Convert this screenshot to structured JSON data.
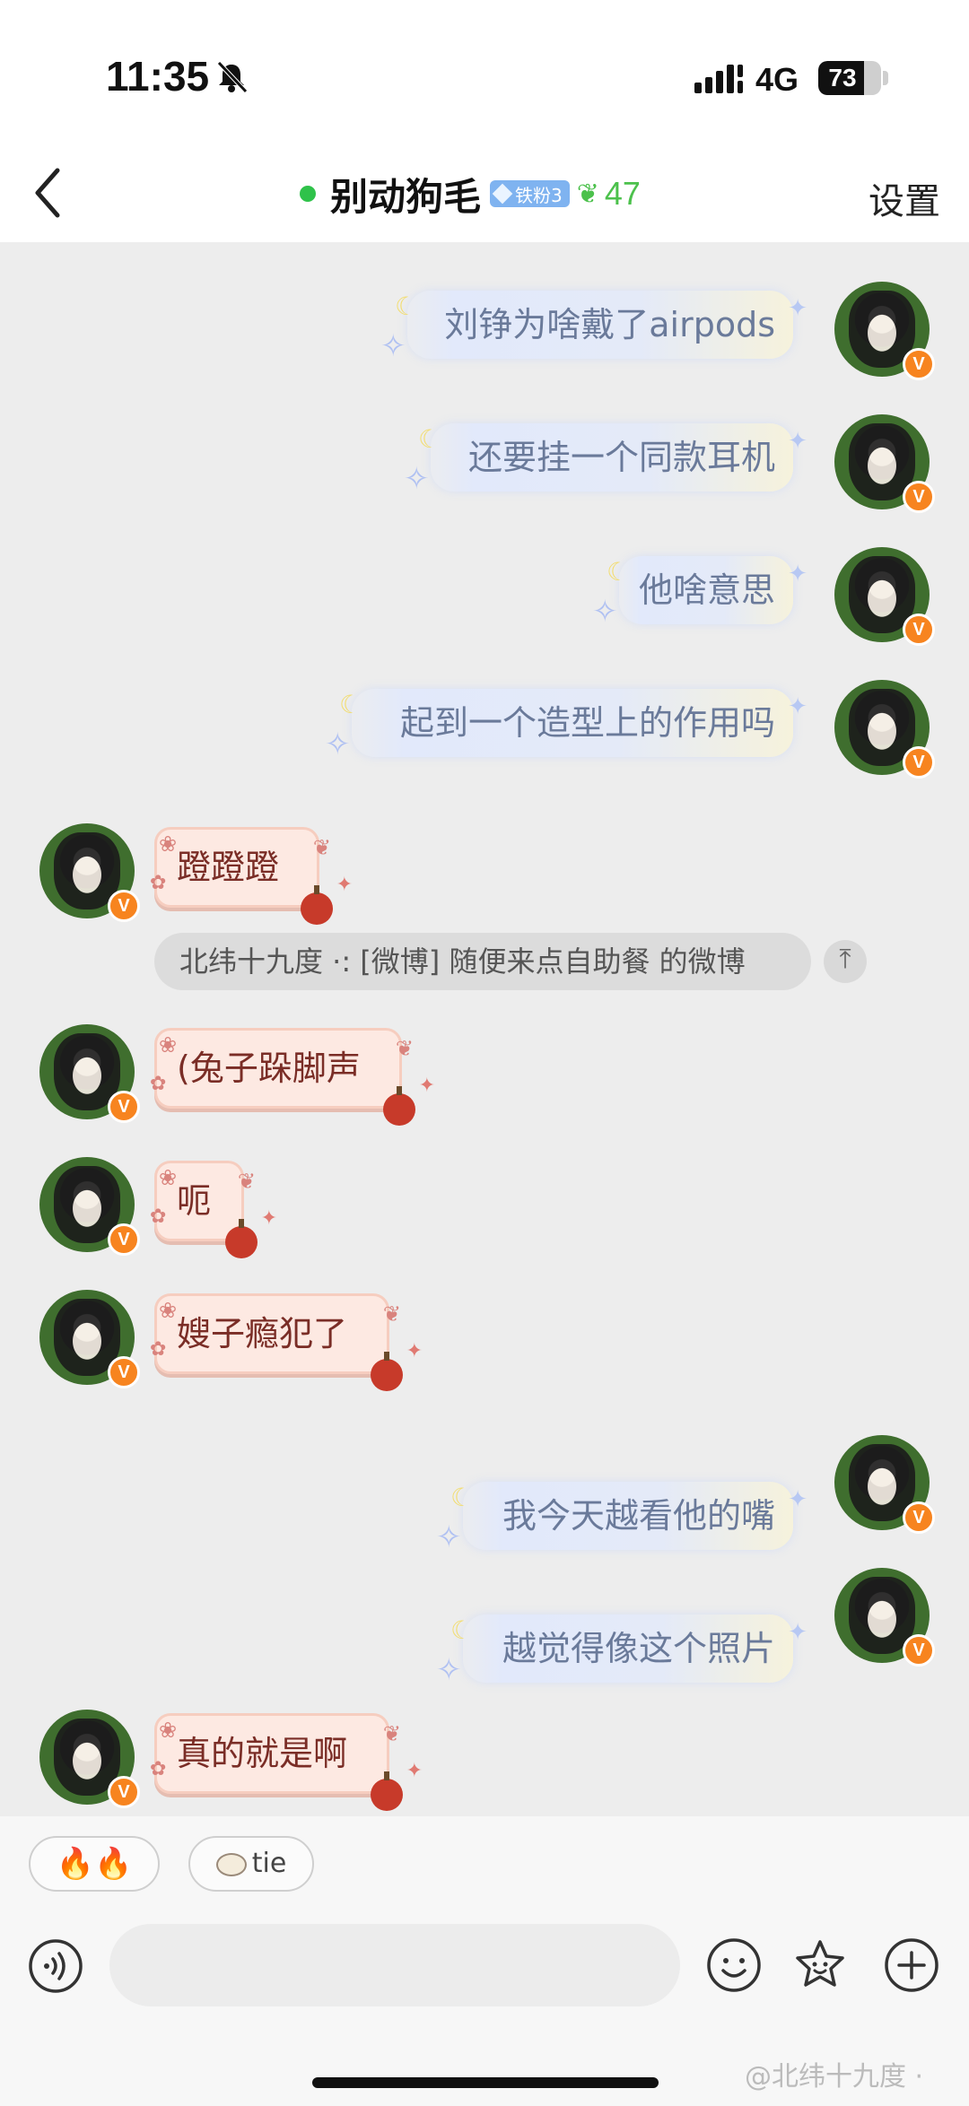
{
  "status_bar": {
    "time": "11:35",
    "network": "4G",
    "battery": "73",
    "battery_level": 0.73,
    "icons": [
      "bell-muted-icon",
      "signal-icon",
      "battery-icon"
    ]
  },
  "header": {
    "back_icon": "chevron-left-icon",
    "title": "别动狗毛",
    "fan_badge": "铁粉3",
    "bow_icon": "green-bow-icon",
    "count": "47",
    "settings_label": "设置"
  },
  "messages": [
    {
      "side": "right",
      "text": "刘铮为啥戴了airpods"
    },
    {
      "side": "right",
      "text": "还要挂一个同款耳机"
    },
    {
      "side": "right",
      "text": "他啥意思"
    },
    {
      "side": "right",
      "text": "起到一个造型上的作用吗"
    },
    {
      "side": "left",
      "text": "蹬蹬蹬"
    },
    {
      "side": "left",
      "text": "(兔子跺脚声"
    },
    {
      "side": "left",
      "text": "呃"
    },
    {
      "side": "left",
      "text": "嫂子瘾犯了"
    },
    {
      "side": "right",
      "text": "我今天越看他的嘴"
    },
    {
      "side": "right",
      "text": "越觉得像这个照片"
    },
    {
      "side": "left",
      "text": "真的就是啊"
    }
  ],
  "quote": {
    "text": "北纬十九度 ·: [微博] 随便来点自助餐 的微博",
    "pin_icon": "pin-top-icon",
    "pin_label": "⤒"
  },
  "verify_mark": "V",
  "quick_replies": {
    "fire_label": "🔥🔥",
    "sheep_label": "tie",
    "sheep_icon": "sheep-icon"
  },
  "input_bar": {
    "placeholder": "",
    "icons": [
      "voice-icon",
      "emoji-icon",
      "sticker-icon",
      "plus-icon"
    ]
  },
  "watermark": "@北纬十九度 ·",
  "colors": {
    "online": "#2fc24a",
    "accent_green": "#4cc14c",
    "verify": "#f7841f",
    "badge": "#7fb3f0"
  }
}
